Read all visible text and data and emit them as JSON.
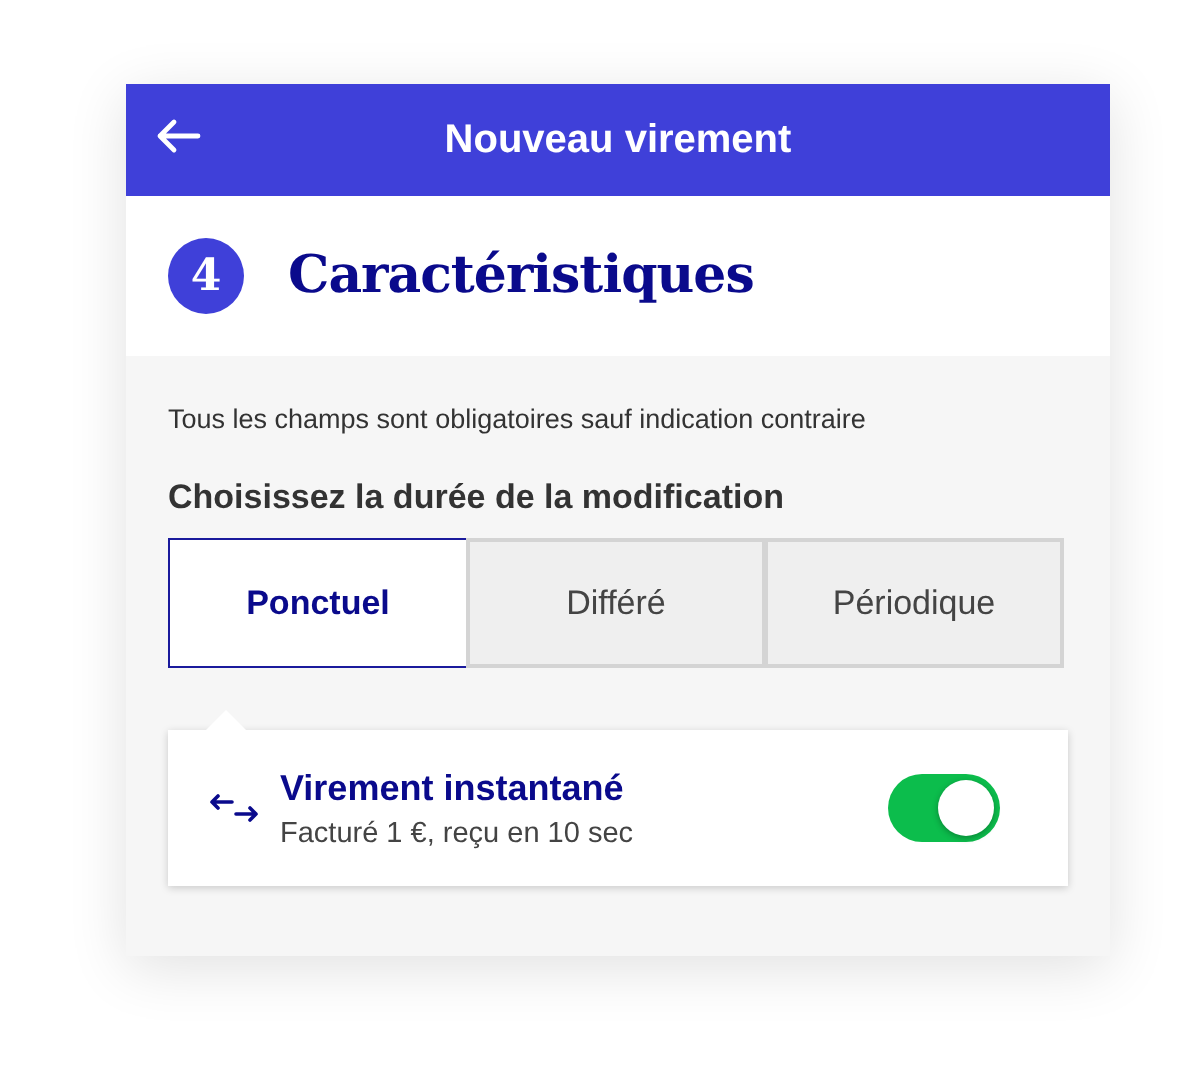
{
  "header": {
    "title": "Nouveau virement"
  },
  "step": {
    "number": "4",
    "title": "Caractéristiques"
  },
  "notice": "Tous les champs sont obligatoires sauf indication contraire",
  "question": "Choisissez la durée de la modification",
  "options": [
    {
      "label": "Ponctuel",
      "selected": true
    },
    {
      "label": "Différé",
      "selected": false
    },
    {
      "label": "Périodique",
      "selected": false
    }
  ],
  "instant": {
    "title": "Virement instantané",
    "subtitle": "Facturé 1 €, reçu en 10 sec",
    "on": true
  }
}
